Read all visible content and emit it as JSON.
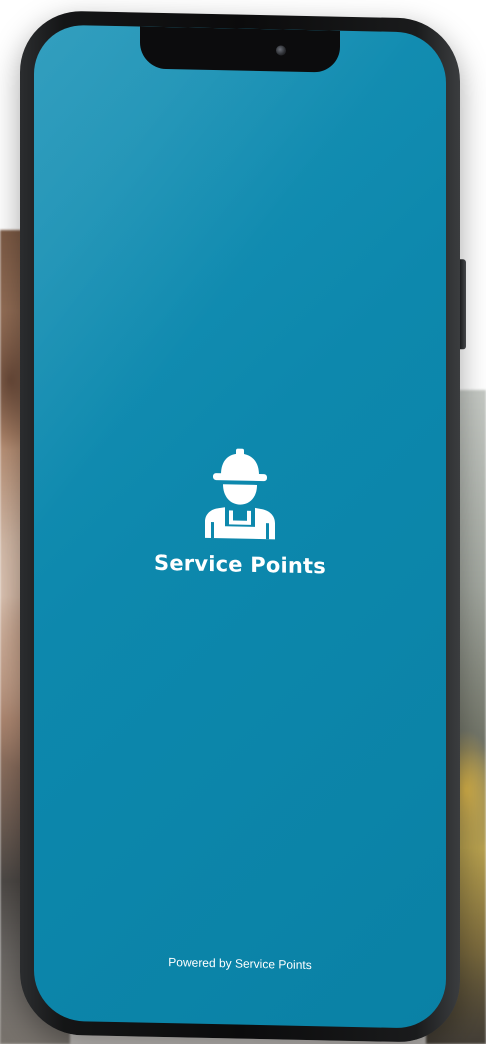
{
  "app": {
    "title": "Service Points",
    "footer": "Powered by Service Points"
  },
  "icons": {
    "logo": "worker-hardhat-icon"
  },
  "colors": {
    "screen_background": "#0d88ad",
    "text": "#ffffff"
  }
}
